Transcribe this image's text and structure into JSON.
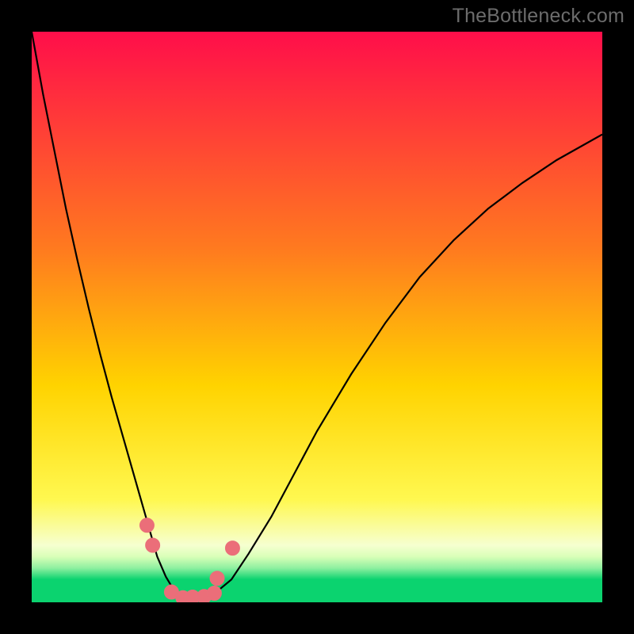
{
  "watermark": "TheBottleneck.com",
  "palette": {
    "grad_top": "#ff0e4a",
    "grad_mid1": "#ff7a1f",
    "grad_mid2": "#ffd300",
    "grad_mid3": "#fff850",
    "grad_low": "#f6ffd0",
    "grad_green": "#0bd36f",
    "curve": "#000000",
    "dot_fill": "#eb6e79",
    "dot_stroke": "#e9707a"
  },
  "chart_data": {
    "type": "line",
    "title": "",
    "xlabel": "",
    "ylabel": "",
    "xlim": [
      0,
      100
    ],
    "ylim": [
      0,
      100
    ],
    "series": [
      {
        "name": "bottleneck-curve",
        "x": [
          0,
          2,
          4,
          6,
          8,
          10,
          12,
          14,
          16,
          18,
          19,
          20,
          21,
          22,
          23.5,
          25,
          26.5,
          28,
          30,
          32,
          35,
          38,
          42,
          46,
          50,
          56,
          62,
          68,
          74,
          80,
          86,
          92,
          100
        ],
        "y": [
          100,
          89,
          79,
          69,
          60,
          51.5,
          43.5,
          36,
          29,
          22,
          18.5,
          15,
          11.5,
          8,
          4.5,
          2,
          1,
          0.5,
          0.5,
          1.5,
          4,
          8.5,
          15,
          22.5,
          30,
          40,
          49,
          57,
          63.5,
          69,
          73.5,
          77.5,
          82
        ]
      }
    ],
    "annotations": [
      {
        "name": "dot-1",
        "x": 20.2,
        "y": 13.5
      },
      {
        "name": "dot-2",
        "x": 21.2,
        "y": 10.0
      },
      {
        "name": "dot-3",
        "x": 24.5,
        "y": 1.8
      },
      {
        "name": "dot-4",
        "x": 26.5,
        "y": 0.8
      },
      {
        "name": "dot-5",
        "x": 28.2,
        "y": 0.9
      },
      {
        "name": "dot-6",
        "x": 30.2,
        "y": 1.0
      },
      {
        "name": "dot-7",
        "x": 32.0,
        "y": 1.6
      },
      {
        "name": "dot-8",
        "x": 32.5,
        "y": 4.2
      },
      {
        "name": "dot-9",
        "x": 35.2,
        "y": 9.5
      }
    ]
  }
}
